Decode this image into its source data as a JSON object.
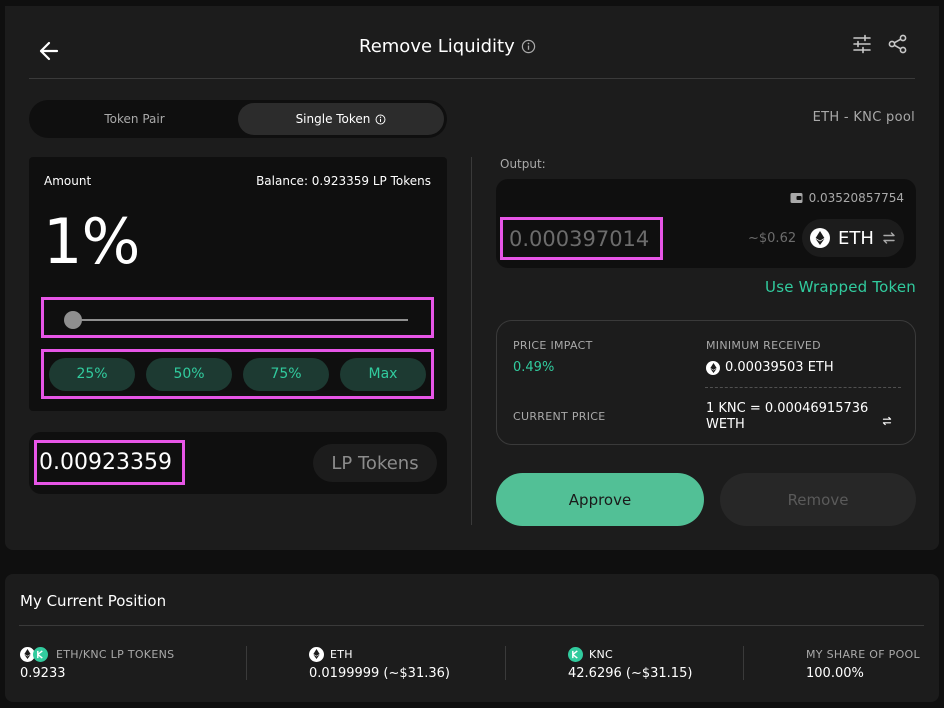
{
  "header": {
    "title": "Remove Liquidity"
  },
  "tabs": [
    {
      "label": "Token Pair"
    },
    {
      "label": "Single Token"
    }
  ],
  "pool_label": "ETH - KNC pool",
  "amount": {
    "label": "Amount",
    "balance": "Balance: 0.923359 LP Tokens",
    "percent": "1%",
    "slider_fraction": 0.01,
    "buttons": [
      "25%",
      "50%",
      "75%",
      "Max"
    ],
    "lp_value": "0.00923359",
    "lp_token": "LP Tokens"
  },
  "output": {
    "label": "Output:",
    "balance": "0.03520857754",
    "value": "0.000397014",
    "usd": "~$0.62",
    "token": "ETH",
    "use_wrapped": "Use Wrapped Token"
  },
  "info": {
    "price_impact_label": "PRICE IMPACT",
    "price_impact_value": "0.49%",
    "min_received_label": "MINIMUM RECEIVED",
    "min_received_value": "0.00039503 ETH",
    "current_price_label": "CURRENT PRICE",
    "current_price_line1": "1 KNC = 0.00046915736",
    "current_price_line2": "WETH"
  },
  "actions": {
    "approve": "Approve",
    "remove": "Remove"
  },
  "position": {
    "title": "My Current Position",
    "lp_label": "ETH/KNC LP TOKENS",
    "lp_value": "0.9233",
    "eth_label": "ETH",
    "eth_value": "0.0199999 (~$31.36)",
    "knc_label": "KNC",
    "knc_value": "42.6296 (~$31.15)",
    "share_label": "MY SHARE OF POOL",
    "share_value": "100.00%"
  },
  "colors": {
    "accent": "#31cb9e",
    "approve_bg": "#52c096",
    "highlight": "#e655e6"
  }
}
